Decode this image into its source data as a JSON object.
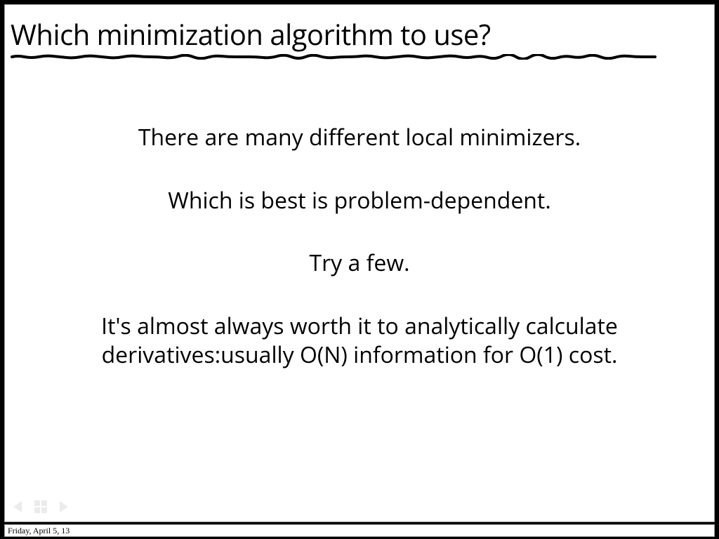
{
  "slide": {
    "title": "Which minimization algorithm to use?",
    "lines": [
      "There are many different local minimizers.",
      "Which is best is problem-dependent.",
      "Try a few.",
      "It's almost always worth it to analytically calculate derivatives:usually O(N) information for O(1) cost."
    ]
  },
  "footer": {
    "date": "Friday, April 5, 13"
  }
}
